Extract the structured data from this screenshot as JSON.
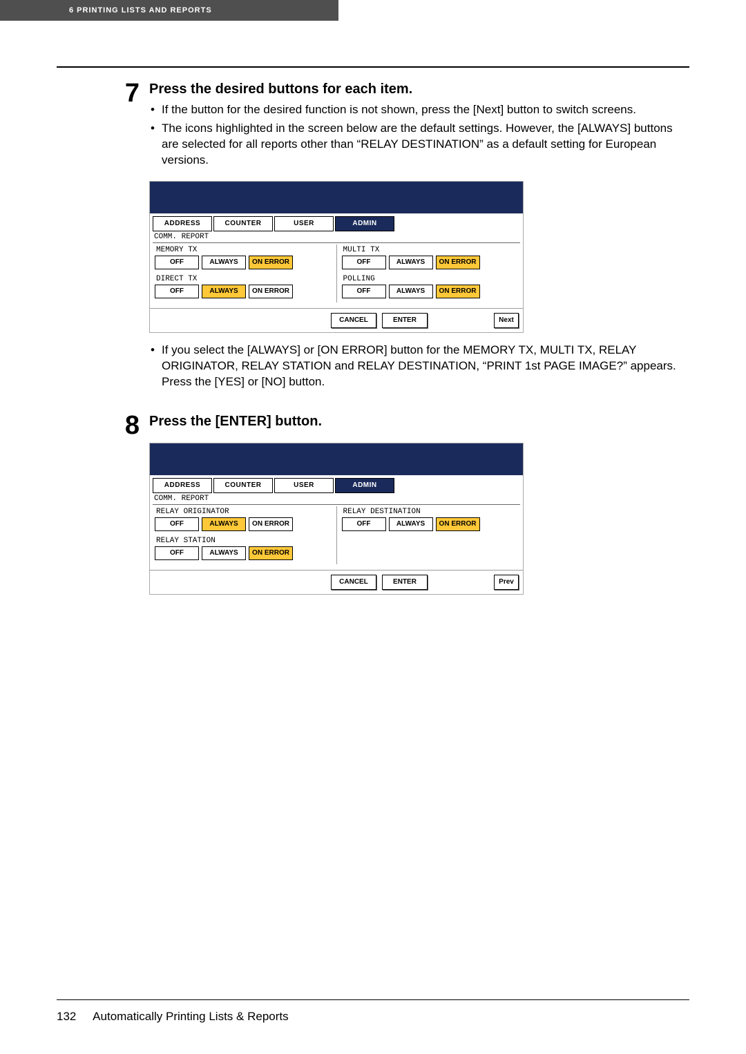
{
  "header": {
    "chapter": "6    PRINTING LISTS AND REPORTS"
  },
  "step7": {
    "num": "7",
    "title": "Press the desired buttons for each item.",
    "bullets": [
      "If the button for the desired function is not shown, press the [Next] button to switch screens.",
      "The icons highlighted in the screen below are the default settings. However, the [ALWAYS] buttons are selected for all reports other than “RELAY DESTINATION” as a default setting for European versions."
    ],
    "note_after": "If you select the [ALWAYS] or [ON ERROR] button for the MEMORY TX, MULTI TX, RELAY ORIGINATOR, RELAY STATION and RELAY DESTINATION, “PRINT 1st PAGE IMAGE?” appears. Press the [YES] or [NO] button."
  },
  "step8": {
    "num": "8",
    "title": "Press the [ENTER] button."
  },
  "screen_common": {
    "tabs": [
      "ADDRESS",
      "COUNTER",
      "USER",
      "ADMIN"
    ],
    "section": "COMM. REPORT",
    "btn_off": "OFF",
    "btn_always": "ALWAYS",
    "btn_onerror": "ON ERROR",
    "cancel": "CANCEL",
    "enter": "ENTER",
    "next": "Next",
    "prev": "Prev"
  },
  "screen1": {
    "left": [
      {
        "label": "MEMORY TX",
        "sel": "onerror"
      },
      {
        "label": "DIRECT TX",
        "sel": "always"
      }
    ],
    "right": [
      {
        "label": "MULTI TX",
        "sel": "onerror"
      },
      {
        "label": "POLLING",
        "sel": "onerror"
      }
    ]
  },
  "screen2": {
    "left": [
      {
        "label": "RELAY ORIGINATOR",
        "sel": "always"
      },
      {
        "label": "RELAY STATION",
        "sel": "onerror"
      }
    ],
    "right": [
      {
        "label": "RELAY DESTINATION",
        "sel": "onerror"
      }
    ]
  },
  "footer": {
    "page": "132",
    "title": "Automatically Printing Lists & Reports"
  }
}
